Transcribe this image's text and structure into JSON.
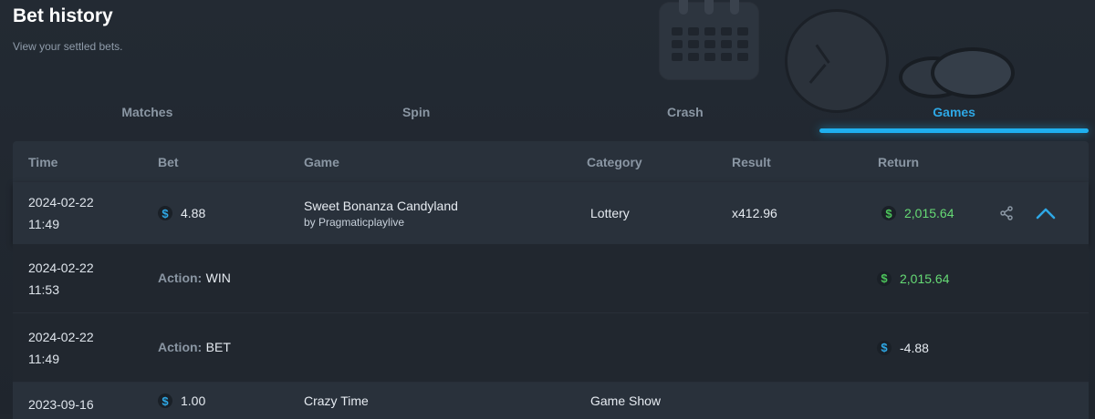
{
  "header": {
    "title": "Bet history",
    "subtitle": "View your settled bets."
  },
  "tabs": [
    {
      "label": "Matches",
      "active": false
    },
    {
      "label": "Spin",
      "active": false
    },
    {
      "label": "Crash",
      "active": false
    },
    {
      "label": "Games",
      "active": true
    }
  ],
  "table": {
    "columns": [
      "Time",
      "Bet",
      "Game",
      "Category",
      "Result",
      "Return"
    ],
    "bet": {
      "date": "2024-02-22",
      "time": "11:49",
      "currency": "$",
      "bet": "4.88",
      "game": "Sweet Bonanza Candyland",
      "provider": "by Pragmaticplaylive",
      "category": "Lottery",
      "result": "x412.96",
      "return": "2,015.64"
    },
    "actions": [
      {
        "date": "2024-02-22",
        "time": "11:53",
        "label": "Action:",
        "value": "WIN",
        "amount": "2,015.64",
        "positive": true
      },
      {
        "date": "2024-02-22",
        "time": "11:49",
        "label": "Action:",
        "value": "BET",
        "amount": "-4.88",
        "positive": false
      }
    ],
    "next_bet": {
      "date": "2023-09-16",
      "bet": "1.00",
      "game": "Crazy Time",
      "category": "Game Show"
    }
  },
  "icons": {
    "share": "share-icon",
    "collapse": "chevron-up-icon",
    "currency": "dollar-icon"
  },
  "colors": {
    "accent": "#2ea8e6",
    "positive": "#66db75",
    "background": "#20262e",
    "row": "#29313b"
  }
}
